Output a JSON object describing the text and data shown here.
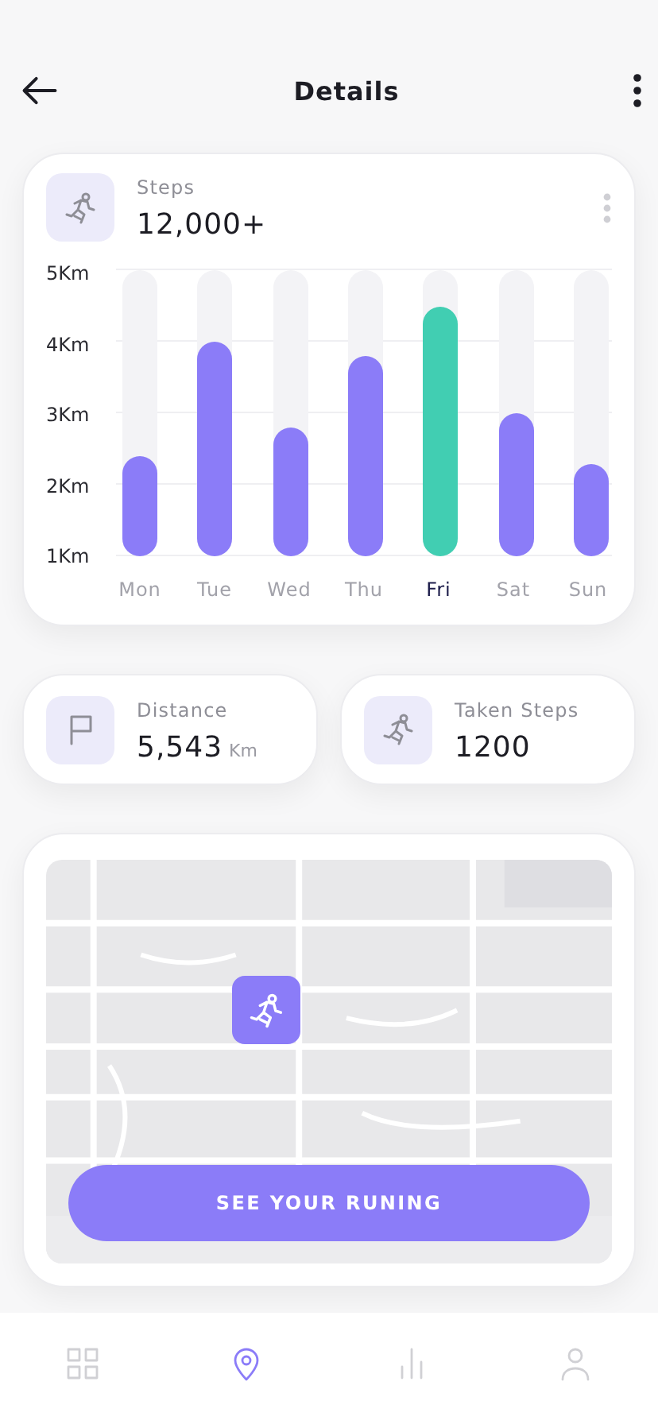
{
  "header": {
    "title": "Details"
  },
  "steps_card": {
    "label": "Steps",
    "value": "12,000+",
    "chart_data": {
      "type": "bar",
      "categories": [
        "Mon",
        "Tue",
        "Wed",
        "Thu",
        "Fri",
        "Sat",
        "Sun"
      ],
      "ylim": [
        1,
        5
      ],
      "yticks": [
        {
          "value": 1,
          "label": "1Km"
        },
        {
          "value": 2,
          "label": "2Km"
        },
        {
          "value": 3,
          "label": "3Km"
        },
        {
          "value": 4,
          "label": "4Km"
        },
        {
          "value": 5,
          "label": "5Km"
        }
      ],
      "series": [
        {
          "color": "#8b7cf8",
          "values": [
            2.4,
            4.0,
            2.8,
            3.8,
            null,
            3.0,
            2.3
          ]
        },
        {
          "color": "#41ceb2",
          "values": [
            null,
            null,
            null,
            null,
            4.5,
            null,
            null
          ]
        }
      ]
    }
  },
  "stats": [
    {
      "kind": "flag",
      "label": "Distance",
      "value": "5,543",
      "unit": "Km"
    },
    {
      "kind": "runner",
      "label": "Taken Steps",
      "value": "1200"
    }
  ],
  "map_card": {
    "button": "SEE YOUR RUNING"
  },
  "nav": [
    {
      "kind": "grid",
      "selected": false
    },
    {
      "kind": "pin",
      "selected": true
    },
    {
      "kind": "bars",
      "selected": false
    },
    {
      "kind": "person",
      "selected": false
    }
  ]
}
